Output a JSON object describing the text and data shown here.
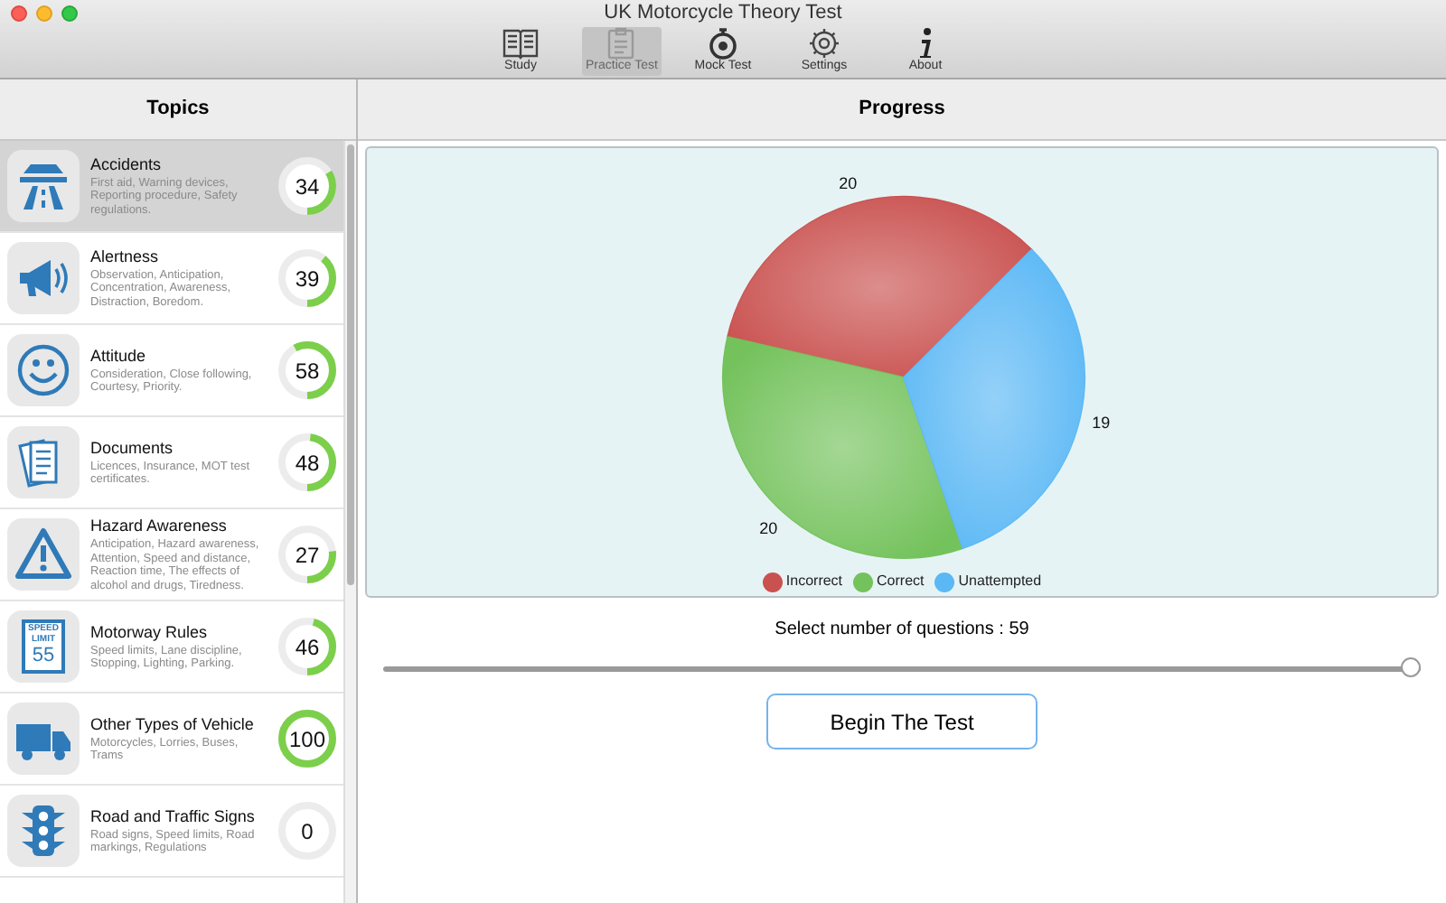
{
  "window": {
    "title": "UK Motorcycle Theory Test"
  },
  "toolbar": [
    {
      "label": "Study",
      "kind": "book",
      "selected": false
    },
    {
      "label": "Practice Test",
      "kind": "clipboard",
      "selected": true
    },
    {
      "label": "Mock Test",
      "kind": "stopwatch",
      "selected": false
    },
    {
      "label": "Settings",
      "kind": "gear",
      "selected": false
    },
    {
      "label": "About",
      "kind": "info",
      "selected": false
    }
  ],
  "sidebar": {
    "title": "Topics",
    "items": [
      {
        "kind": "road",
        "title": "Accidents",
        "description": "First aid, Warning devices, Reporting procedure, Safety regulations.",
        "score": "34",
        "level": 0.34,
        "selected": true
      },
      {
        "kind": "megaphone",
        "title": "Alertness",
        "description": "Observation, Anticipation, Concentration, Awareness, Distraction, Boredom.",
        "score": "39",
        "level": 0.39,
        "selected": false
      },
      {
        "kind": "smiley",
        "title": "Attitude",
        "description": "Consideration, Close following, Courtesy, Priority.",
        "score": "58",
        "level": 0.58,
        "selected": false
      },
      {
        "kind": "documents",
        "title": "Documents",
        "description": "Licences, Insurance, MOT test certificates.",
        "score": "48",
        "level": 0.48,
        "selected": false
      },
      {
        "kind": "warning",
        "title": "Hazard Awareness",
        "description": "Anticipation, Hazard awareness, Attention, Speed and distance, Reaction time, The effects of alcohol and drugs, Tiredness.",
        "score": "27",
        "level": 0.27,
        "selected": false
      },
      {
        "kind": "speedsign",
        "title": "Motorway Rules",
        "description": "Speed limits, Lane discipline, Stopping, Lighting, Parking.",
        "score": "46",
        "level": 0.46,
        "selected": false,
        "icon_text": [
          "SPEED",
          "LIMIT",
          "55"
        ]
      },
      {
        "kind": "truck",
        "title": "Other Types of Vehicle",
        "description": "Motorcycles, Lorries, Buses, Trams",
        "score": "100",
        "level": 1,
        "selected": false
      },
      {
        "kind": "trafficlight",
        "title": "Road and Traffic Signs",
        "description": "Road signs, Speed limits, Road markings, Regulations",
        "score": "0",
        "level": 0,
        "selected": false
      }
    ]
  },
  "progress": {
    "title": "Progress",
    "chart_data": {
      "type": "pie",
      "categories": [
        "Incorrect",
        "Correct",
        "Unattempted"
      ],
      "values": [
        20,
        20,
        19
      ],
      "colors": [
        "#c9514f",
        "#74c25c",
        "#5bb8f5"
      ],
      "data_labels": true,
      "legend": true
    },
    "slider_label": "Select number of questions : 59",
    "slider": {
      "level": 1
    },
    "button": "Begin The Test"
  }
}
